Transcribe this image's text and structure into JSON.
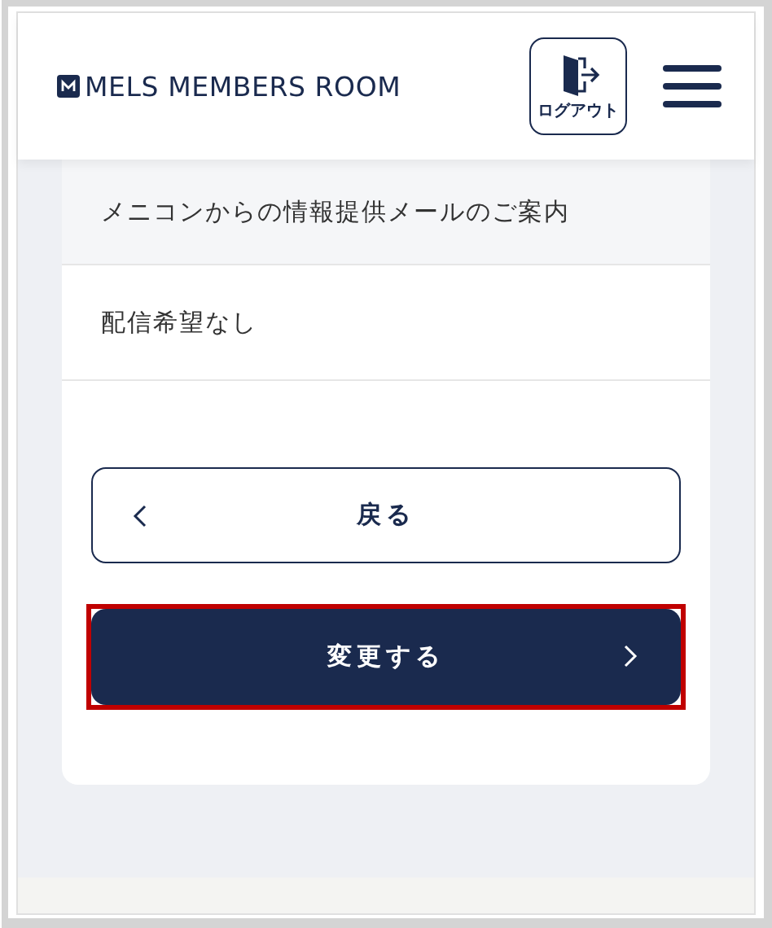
{
  "header": {
    "brand": "MELS MEMBERS ROOM",
    "logout_label": "ログアウト"
  },
  "rows": [
    {
      "kind": "heading",
      "text": "メニコンからの情報提供メールのご案内"
    },
    {
      "kind": "value",
      "text": "配信希望なし"
    }
  ],
  "buttons": [
    {
      "kind": "back",
      "label": "戻る",
      "highlighted": false
    },
    {
      "kind": "primary",
      "label": "変更する",
      "highlighted": true
    }
  ]
}
